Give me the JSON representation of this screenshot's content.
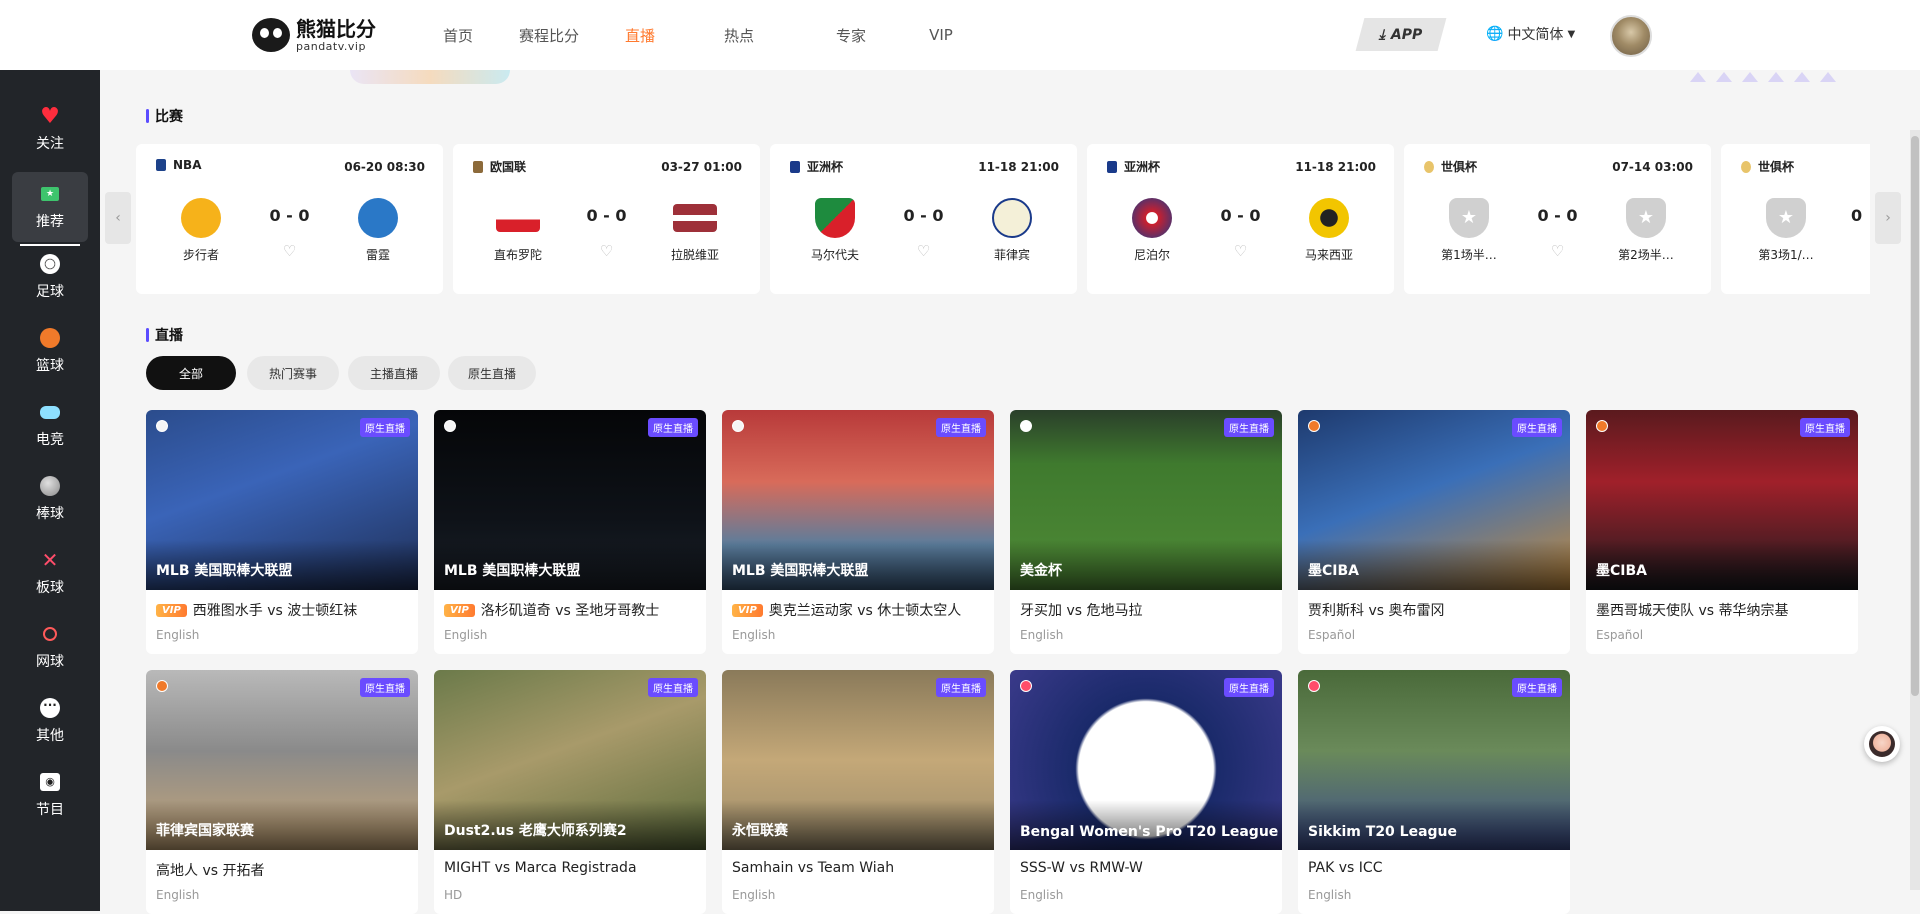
{
  "logo": {
    "cn": "熊猫比分",
    "en": "pandatv.vip"
  },
  "nav": [
    {
      "label": "首页"
    },
    {
      "label": "赛程比分"
    },
    {
      "label": "直播",
      "active": true
    },
    {
      "label": "热点"
    },
    {
      "label": "专家"
    },
    {
      "label": "VIP"
    }
  ],
  "header": {
    "app_label": "APP",
    "lang_label": "中文简体"
  },
  "sidebar": {
    "items": [
      {
        "label": "关注",
        "icon": "heart-icon"
      },
      {
        "label": "推荐",
        "icon": "recommend-icon",
        "active": true
      },
      {
        "label": "足球",
        "icon": "football-icon"
      },
      {
        "label": "篮球",
        "icon": "basketball-icon"
      },
      {
        "label": "电竞",
        "icon": "gamepad-icon"
      },
      {
        "label": "棒球",
        "icon": "baseball-icon"
      },
      {
        "label": "板球",
        "icon": "cricket-icon"
      },
      {
        "label": "网球",
        "icon": "tennis-icon"
      },
      {
        "label": "其他",
        "icon": "more-icon"
      },
      {
        "label": "节目",
        "icon": "program-icon"
      }
    ]
  },
  "sections": {
    "matches_title": "比赛",
    "live_title": "直播"
  },
  "matches": [
    {
      "league": "NBA",
      "time": "06-20 08:30",
      "home": "步行者",
      "away": "雷霆",
      "score": "0 - 0",
      "home_color": "#f6b21a",
      "away_color": "#2a78c7"
    },
    {
      "league": "欧国联",
      "time": "03-27 01:00",
      "home": "直布罗陀",
      "away": "拉脱维亚",
      "score": "0 - 0",
      "home_color": "#d9202a",
      "away_color": "#9e3039"
    },
    {
      "league": "亚洲杯",
      "time": "11-18 21:00",
      "home": "马尔代夫",
      "away": "菲律宾",
      "score": "0 - 0",
      "home_color": "#1e8b3e",
      "away_color": "#e8e4c9"
    },
    {
      "league": "亚洲杯",
      "time": "11-18 21:00",
      "home": "尼泊尔",
      "away": "马来西亚",
      "score": "0 - 0",
      "home_color": "#cc1f2d",
      "away_color": "#f2c500"
    },
    {
      "league": "世俱杯",
      "time": "07-14 03:00",
      "home": "第1场半…",
      "away": "第2场半…",
      "score": "0 - 0",
      "home_color": "#d0d0d0",
      "away_color": "#d0d0d0"
    },
    {
      "league": "世俱杯",
      "time": "",
      "home": "第3场1/…",
      "away": "",
      "score": "0",
      "home_color": "#d0d0d0",
      "away_color": "#d0d0d0"
    }
  ],
  "filters": [
    {
      "label": "全部",
      "active": true
    },
    {
      "label": "热门赛事"
    },
    {
      "label": "主播直播"
    },
    {
      "label": "原生直播"
    }
  ],
  "live_tag": "原生直播",
  "vip_label": "VIP",
  "streams": [
    {
      "league": "MLB 美国职棒大联盟",
      "title": "西雅图水手 vs 波士顿红袜",
      "lang": "English",
      "vip": true,
      "bg": "linear-gradient(160deg,#2b4c8c 0%,#3a64b8 40%,#1e2e55 100%)"
    },
    {
      "league": "MLB 美国职棒大联盟",
      "title": "洛杉矶道奇 vs 圣地牙哥教士",
      "lang": "English",
      "vip": true,
      "bg": "linear-gradient(180deg,#050608 0%,#0e1218 60%,#1a2028 100%)"
    },
    {
      "league": "MLB 美国职棒大联盟",
      "title": "奥克兰运动家 vs 休士顿太空人",
      "lang": "English",
      "vip": true,
      "bg": "linear-gradient(180deg,#b83a3a 0%,#d86b5a 40%,#5b7d9c 75%,#3b5a7c 100%)"
    },
    {
      "league": "美金杯",
      "title": "牙买加 vs 危地马拉",
      "lang": "English",
      "vip": false,
      "bg": "linear-gradient(180deg,#2a3f2a 0%,#3f7a2e 30%,#4f8a36 100%)"
    },
    {
      "league": "墨CIBA",
      "title": "贾利斯科 vs 奥布雷冈",
      "lang": "Español",
      "vip": false,
      "bg": "linear-gradient(160deg,#1e3a6e 0%,#3a6fb8 45%,#c48a3a 100%)"
    },
    {
      "league": "墨CIBA",
      "title": "墨西哥城天使队 vs 蒂华纳宗基",
      "lang": "Español",
      "vip": false,
      "bg": "linear-gradient(180deg,#5a1a1e 0%,#a0202a 40%,#1a1a1e 100%)"
    },
    {
      "league": "菲律宾国家联赛",
      "title": "高地人 vs 开拓者",
      "lang": "English",
      "vip": false,
      "bg": "linear-gradient(180deg,#b9b9b9 0%,#8a8a8a 45%,#c9a878 100%)"
    },
    {
      "league": "Dust2.us 老鹰大师系列赛2",
      "title": "MIGHT vs Marca Registrada",
      "lang": "HD",
      "vip": false,
      "bg": "linear-gradient(160deg,#6b7a4a 0%,#a89a6a 45%,#5a6a3a 100%)"
    },
    {
      "league": "永恒联赛",
      "title": "Samhain vs Team Wiah",
      "lang": "English",
      "vip": false,
      "bg": "linear-gradient(180deg,#8a7a5a 0%,#c4a878 50%,#9a8a6a 100%)"
    },
    {
      "league": "Bengal Women's Pro T20 League",
      "title": "SSS-W vs RMW-W",
      "lang": "English",
      "vip": false,
      "bg": "radial-gradient(circle at 50% 55%,#ffffff 0,#ffffff 40%,#1a2a6a 42%,#3a3a8a 100%)"
    },
    {
      "league": "Sikkim T20 League",
      "title": "PAK vs ICC",
      "lang": "English",
      "vip": false,
      "bg": "linear-gradient(180deg,#4a6a3a 0%,#6a8a5a 45%,#3a4a8a 100%)"
    }
  ],
  "colors": {
    "accent": "#ff7a2f",
    "tag": "#6a4cff",
    "sidebar_bg": "#222529"
  }
}
